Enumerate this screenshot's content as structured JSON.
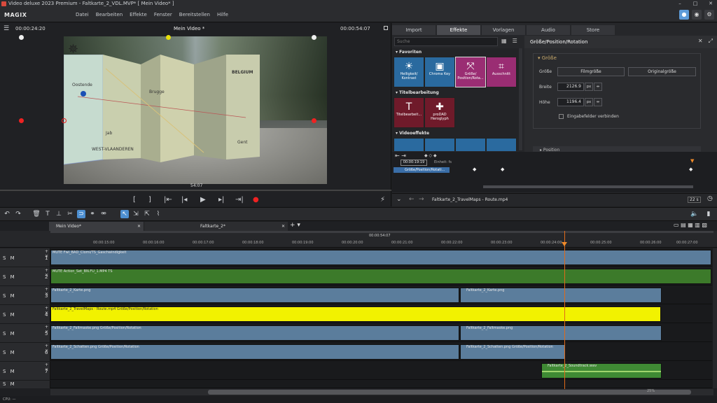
{
  "window": {
    "title": "Video deluxe 2023 Premium - Faltkarte_2_VDL.MVP* [ Mein Video* ]"
  },
  "menubar": {
    "logo": "MAGIX",
    "menus": [
      "Datei",
      "Bearbeiten",
      "Effekte",
      "Fenster",
      "Bereitstellen",
      "Hilfe"
    ]
  },
  "preview": {
    "timecode_left": "00:00:24:20",
    "title": "Mein Video *",
    "timecode_right": "00:00:54:07",
    "current_time": "54:07",
    "map_labels": [
      "BELGIUM",
      "Oostende",
      "Brugge",
      "Gent",
      "WEST-VLAANDEREN",
      "Jab"
    ]
  },
  "tabs": [
    "Import",
    "Effekte",
    "Vorlagen",
    "Audio",
    "Store"
  ],
  "active_tab": "Effekte",
  "effects": {
    "search_placeholder": "Suche",
    "cat_favorites": "Favoriten",
    "cat_title": "Titelbearbeitung",
    "cat_video": "Videoeffekte",
    "fav_tiles": [
      {
        "label1": "Helligkeit/",
        "label2": "Kontrast"
      },
      {
        "label1": "Chroma Key",
        "label2": ""
      },
      {
        "label1": "Größe/",
        "label2": "Position/Rota..."
      },
      {
        "label1": "Ausschnitt",
        "label2": ""
      }
    ],
    "title_tiles": [
      {
        "label1": "Titelbearbeit...",
        "label2": ""
      },
      {
        "label1": "proDAD",
        "label2": "Heroglyph"
      }
    ]
  },
  "properties": {
    "header": "Größe/Position/Rotation",
    "group_title": "Größe",
    "size_label": "Größe",
    "btn_film": "Filmgröße",
    "btn_original": "Originalgröße",
    "width_label": "Breite",
    "width_value": "2126.9",
    "height_label": "Höhe",
    "height_value": "1196.4",
    "unit": "px",
    "checkbox_label": "Eingabefelder verbinden",
    "position_header": "Position"
  },
  "keyframes": {
    "time": "00:00:19:19",
    "unit_label": "Einheit: fs",
    "track_label": "Größe/Position/Rotati..."
  },
  "filebar": {
    "filename": "Faltkarte_2_TravelMaps - Route.mp4",
    "zoom": "22 s"
  },
  "arrangement": {
    "tab1": "Mein Video*",
    "tab2": "Faltkarte_2*",
    "position_time": "00:00:54:07",
    "ruler_ticks": [
      "00:00:15:00",
      "00:00:16:00",
      "00:00:17:00",
      "00:00:18:00",
      "00:00:19:00",
      "00:00:20:00",
      "00:00:21:00",
      "00:00:22:00",
      "00:00:23:00",
      "00:00:24:00",
      "00:00:25:00",
      "00:00:26:00",
      "00:00:27:00"
    ]
  },
  "tracks": [
    {
      "num": "1",
      "clips": [
        {
          "label": "MUTE Fwi_BAD_Clomi/TS_Gaschwindigkeit",
          "kind": "blue"
        }
      ]
    },
    {
      "num": "2",
      "clips": [
        {
          "label": "MUTE Action_Set_BN.FU_1.MP4  TS",
          "kind": "green"
        }
      ]
    },
    {
      "num": "3",
      "clips": [
        {
          "label": "Faltkarte_2_Karte.png",
          "kind": "blue"
        },
        {
          "label": "Faltkarte_2_Karte.png",
          "kind": "blue"
        }
      ]
    },
    {
      "num": "4",
      "clips": [
        {
          "label": "Faltkarte_2_TravelMaps - Route.mp4   Größe/Position/Rotation",
          "kind": "yellow"
        }
      ]
    },
    {
      "num": "5",
      "clips": [
        {
          "label": "Faltkarte_2_Faltmaske.png   Größe/Position/Rotation",
          "kind": "blue"
        },
        {
          "label": "Faltkarte_2_Faltmaske.png",
          "kind": "blue"
        }
      ]
    },
    {
      "num": "6",
      "clips": [
        {
          "label": "Faltkarte_2_Schatten.png   Größe/Position/Rotation",
          "kind": "blue"
        },
        {
          "label": "Faltkarte_2_Schatten.png   Größe/Position/Rotation",
          "kind": "blue"
        }
      ]
    },
    {
      "num": "7",
      "clips": [
        {
          "label": "Faltkarte_2_Soundtrack.wav",
          "kind": "audio"
        }
      ]
    }
  ],
  "track_controls": "S M",
  "status": {
    "cpu": "CPU: —",
    "zoom_percent": "25%"
  },
  "colors": {
    "accent": "#5d9bd8",
    "playhead": "#e06a19"
  }
}
